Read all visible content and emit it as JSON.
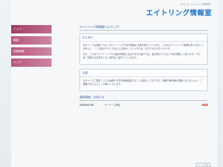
{
  "header": {
    "tagline": "ようこそ、エイトリング情報室へ",
    "title": "エイトリング情報室"
  },
  "sidebar": {
    "items": [
      {
        "label": "トップ",
        "active": true
      },
      {
        "label": "概要"
      },
      {
        "label": "詳細情報"
      },
      {
        "label": "リンク"
      }
    ]
  },
  "main": {
    "welcome_heading": "エイトリング情報館へようこそ！",
    "intro_box": {
      "title": "はじめに",
      "p1": "当サイトでは漫画『Inn』のエイトリングの自作動画に全集を紹介しています。これからエイトリング登場を見てみたいとお考えに、「この話のやりとりはどんな話か」といった方は、ぜひ下からの方へどうぞ。",
      "p2": "また、これまでエイトリングの出番が特徴に注目する方の紹介では、話を掲げてさらに人気を更新して参ります。その他、関連する記事などのご案内をご紹介していきます。"
    },
    "note_box": {
      "title": "注意",
      "p1": "当サイトでご提供している画像や文章を無断転載することは禁止しております。誤解や著作権の侵害とならないよう、ご理解のほどよろしくお願いいたします。"
    },
    "updates": {
      "title": "更新情報・お知らせ",
      "rows": [
        {
          "date": "2018/03/26",
          "text": "サーバーに移転",
          "badge": "NEW"
        }
      ]
    }
  },
  "footer": {
    "pagetop": "ページTOP"
  }
}
